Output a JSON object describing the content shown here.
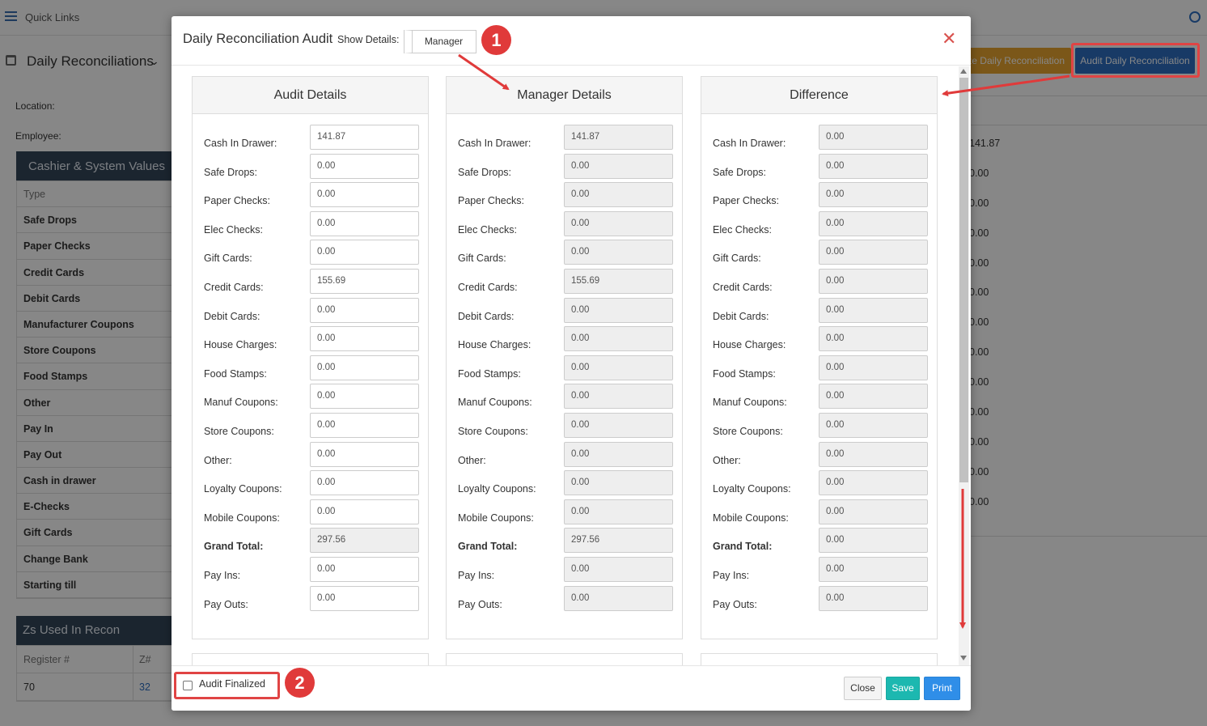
{
  "background": {
    "quick_links": "Quick Links",
    "page_title": "Daily Reconciliations",
    "finalize_button": "ize Daily Reconciliation",
    "audit_button": "Audit Daily Reconciliation",
    "location_label": "Location:",
    "employee_label": "Employee:",
    "cashier_panel_title": "Cashier & System Values",
    "type_header": "Type",
    "rows": [
      "Safe Drops",
      "Paper Checks",
      "Credit Cards",
      "Debit Cards",
      "Manufacturer Coupons",
      "Store Coupons",
      "Food Stamps",
      "Other",
      "Pay In",
      "Pay Out",
      "Cash in drawer",
      "E-Checks",
      "Gift Cards",
      "Change Bank",
      "Starting till"
    ],
    "zs_panel_title": "Zs Used In Recon",
    "zs_headers": [
      "Register #",
      "Z#"
    ],
    "zs_row": [
      "70",
      "32"
    ],
    "right_values": [
      "141.87",
      "0.00",
      "0.00",
      "0.00",
      "0.00",
      "0.00",
      "0.00",
      "0.00",
      "0.00",
      "0.00",
      "0.00",
      "0.00",
      "0.00"
    ]
  },
  "modal": {
    "title": "Daily Reconciliation Audit",
    "show_details_label": "Show Details:",
    "show_details_value": "Manager",
    "close_icon": "close-icon",
    "columns": [
      {
        "title": "Audit Details",
        "values": [
          "141.87",
          "0.00",
          "0.00",
          "0.00",
          "0.00",
          "155.69",
          "0.00",
          "0.00",
          "0.00",
          "0.00",
          "0.00",
          "0.00",
          "0.00",
          "0.00",
          "297.56",
          "0.00",
          "0.00"
        ]
      },
      {
        "title": "Manager Details",
        "values": [
          "141.87",
          "0.00",
          "0.00",
          "0.00",
          "0.00",
          "155.69",
          "0.00",
          "0.00",
          "0.00",
          "0.00",
          "0.00",
          "0.00",
          "0.00",
          "0.00",
          "297.56",
          "0.00",
          "0.00"
        ]
      },
      {
        "title": "Difference",
        "values": [
          "0.00",
          "0.00",
          "0.00",
          "0.00",
          "0.00",
          "0.00",
          "0.00",
          "0.00",
          "0.00",
          "0.00",
          "0.00",
          "0.00",
          "0.00",
          "0.00",
          "0.00",
          "0.00",
          "0.00"
        ]
      }
    ],
    "field_labels": [
      "Cash In Drawer:",
      "Safe Drops:",
      "Paper Checks:",
      "Elec Checks:",
      "Gift Cards:",
      "Credit Cards:",
      "Debit Cards:",
      "House Charges:",
      "Food Stamps:",
      "Manuf Coupons:",
      "Store Coupons:",
      "Other:",
      "Loyalty Coupons:",
      "Mobile Coupons:",
      "Grand Total:",
      "Pay Ins:",
      "Pay Outs:"
    ],
    "audit_finalized_label": "Audit Finalized",
    "buttons": {
      "close": "Close",
      "save": "Save",
      "print": "Print"
    }
  },
  "annotations": {
    "badge1": "1",
    "badge2": "2"
  },
  "colors": {
    "primary": "#2f6fc0",
    "warning": "#e8a530",
    "annotation": "#e03a3a",
    "save": "#1cb8b0",
    "print": "#2f8ee8"
  }
}
